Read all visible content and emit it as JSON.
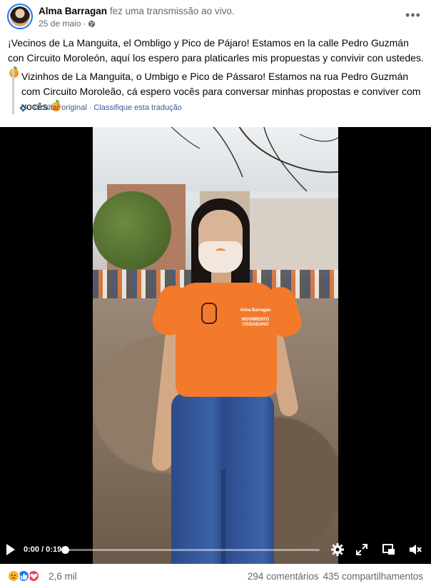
{
  "post": {
    "author": "Alma Barragan",
    "action": "fez uma transmissão ao vivo.",
    "date": "25 de maio",
    "separator": "·",
    "more_label": "•••",
    "text": "¡Vecinos de La Manguita, el Ombligo y Pico de Pájaro! Estamos en la calle Pedro Guzmán con Circuito Moroleón, aquí los espero para platicarles mis propuestas y convivir con ustedes.",
    "translation": "Vizinhos de La Manguita, o Umbigo e Pico de Pássaro! Estamos na rua Pedro Guzmán com Circuito Moroleão, cá espero vocês para conversar minhas propostas e conviver com vocês.",
    "hide_original": "Ocultar original",
    "link_separator": "·",
    "rate_translation": "Classifique esta tradução"
  },
  "video": {
    "time_label": "0:00 / 0:19",
    "progress": 0.0,
    "shirt_name": "Alma Barragan",
    "shirt_brand": "MOVIMIENTO CIUDADANO"
  },
  "footer": {
    "reactions": [
      "sad-icon",
      "like-icon",
      "love-icon"
    ],
    "reaction_count": "2,6 mil",
    "comments": "294 comentários",
    "shares": "435 compartilhamentos"
  },
  "colors": {
    "accent": "#1877f2",
    "secondary_text": "#65676b",
    "link": "#385898",
    "shirt": "#f27a2a"
  }
}
